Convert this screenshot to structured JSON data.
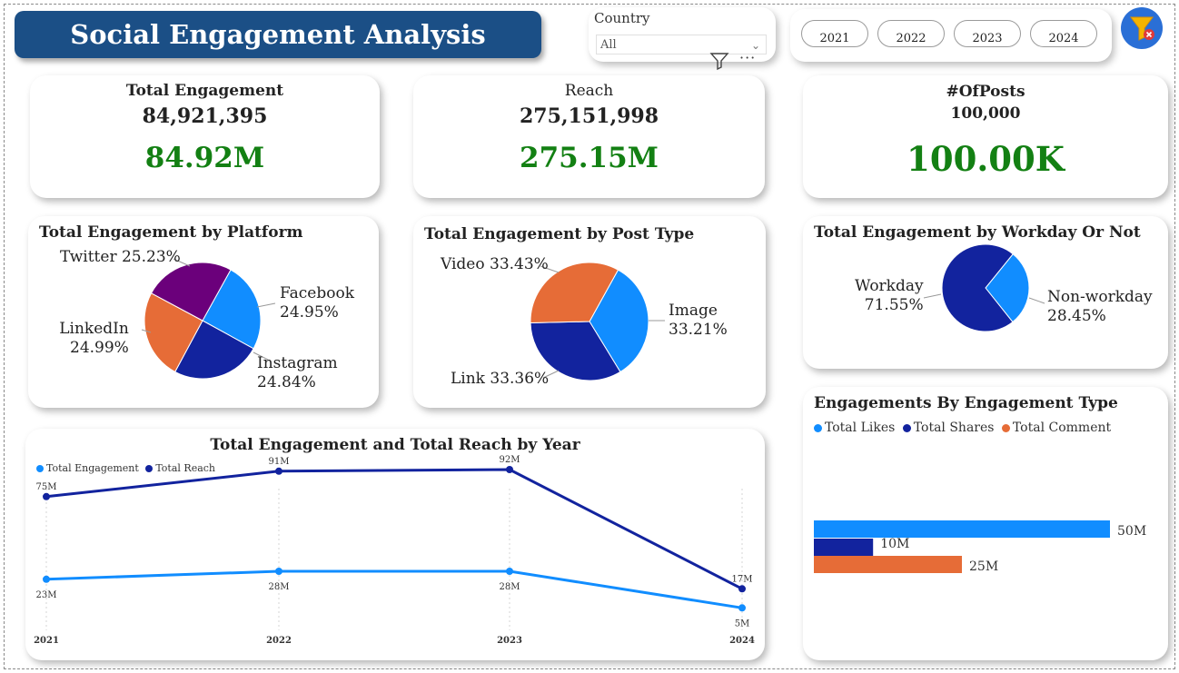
{
  "header": {
    "title": "Social Engagement Analysis"
  },
  "country_slicer": {
    "label": "Country",
    "selected": "All"
  },
  "year_buttons": [
    "2021",
    "2022",
    "2023",
    "2024"
  ],
  "kpis": {
    "engagement": {
      "title": "Total Engagement",
      "value": "84,921,395",
      "big": "84.92M"
    },
    "reach": {
      "title": "Reach",
      "value": "275,151,998",
      "big": "275.15M"
    },
    "posts": {
      "title": "#OfPosts",
      "value": "100,000",
      "big": "100.00K"
    }
  },
  "platform": {
    "title": "Total Engagement by Platform",
    "labels": {
      "twitter": "Twitter 25.23%",
      "facebook": [
        "Facebook",
        "24.95%"
      ],
      "linkedin": [
        "LinkedIn",
        "24.99%"
      ],
      "instagram": [
        "Instagram",
        "24.84%"
      ]
    }
  },
  "post_type": {
    "title": "Total Engagement by Post Type",
    "labels": {
      "video": "Video 33.43%",
      "image": [
        "Image",
        "33.21%"
      ],
      "link": "Link 33.36%"
    }
  },
  "workday": {
    "title": "Total Engagement by Workday Or Not",
    "labels": {
      "workday": [
        "Workday",
        "71.55%"
      ],
      "non_workday": [
        "Non-workday",
        "28.45%"
      ]
    }
  },
  "engagement_type": {
    "title": "Engagements By Engagement Type",
    "legend": [
      "Total Likes",
      "Total Shares",
      "Total Comment"
    ],
    "value_labels": [
      "50M",
      "10M",
      "25M"
    ]
  },
  "line_chart": {
    "title": "Total Engagement and Total Reach by Year",
    "legend": [
      "Total Engagement",
      "Total Reach"
    ]
  },
  "colors": {
    "navy": "#1b4f86",
    "blue": "#118dff",
    "darkblue": "#12239e",
    "orange": "#e66c37",
    "purple": "#6b007b",
    "green": "#138013"
  },
  "chart_data": [
    {
      "type": "pie",
      "title": "Total Engagement by Platform",
      "categories": [
        "Facebook",
        "Instagram",
        "LinkedIn",
        "Twitter"
      ],
      "values": [
        24.95,
        24.84,
        24.99,
        25.23
      ],
      "colors": [
        "#118dff",
        "#12239e",
        "#e66c37",
        "#6b007b"
      ]
    },
    {
      "type": "pie",
      "title": "Total Engagement by Post Type",
      "categories": [
        "Image",
        "Link",
        "Video"
      ],
      "values": [
        33.21,
        33.36,
        33.43
      ],
      "colors": [
        "#118dff",
        "#12239e",
        "#e66c37"
      ]
    },
    {
      "type": "pie",
      "title": "Total Engagement by Workday Or Not",
      "categories": [
        "Non-workday",
        "Workday"
      ],
      "values": [
        28.45,
        71.55
      ],
      "colors": [
        "#118dff",
        "#12239e"
      ]
    },
    {
      "type": "bar",
      "title": "Engagements By Engagement Type",
      "orientation": "horizontal",
      "series": [
        {
          "name": "Total Likes",
          "values": [
            50
          ]
        },
        {
          "name": "Total Shares",
          "values": [
            10
          ]
        },
        {
          "name": "Total Comment",
          "values": [
            25
          ]
        }
      ],
      "unit": "M"
    },
    {
      "type": "line",
      "title": "Total Engagement and Total Reach by Year",
      "x": [
        "2021",
        "2022",
        "2023",
        "2024"
      ],
      "series": [
        {
          "name": "Total Engagement",
          "values": [
            23,
            28,
            28,
            5
          ],
          "labels": [
            "23M",
            "28M",
            "28M",
            "5M"
          ]
        },
        {
          "name": "Total Reach",
          "values": [
            75,
            91,
            92,
            17
          ],
          "labels": [
            "75M",
            "91M",
            "92M",
            "17M"
          ]
        }
      ],
      "ylim": [
        0,
        100
      ]
    }
  ]
}
